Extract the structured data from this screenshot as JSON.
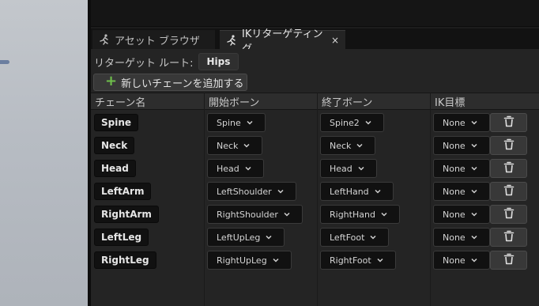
{
  "tabs": [
    {
      "label": "アセット ブラウザ",
      "icon": "running-figure-icon",
      "active": false
    },
    {
      "label": "IKリターゲティング",
      "icon": "running-figure-icon",
      "active": true,
      "close": "×"
    }
  ],
  "root": {
    "label": "リターゲット ルート:",
    "value": "Hips"
  },
  "add_chain": {
    "label": "新しいチェーンを追加する",
    "icon": "plus-icon"
  },
  "columns": [
    "チェーン名",
    "開始ボーン",
    "終了ボーン",
    "IK目標"
  ],
  "chains": [
    {
      "name": "Spine",
      "start": "Spine",
      "end": "Spine2",
      "ik": "None"
    },
    {
      "name": "Neck",
      "start": "Neck",
      "end": "Neck",
      "ik": "None"
    },
    {
      "name": "Head",
      "start": "Head",
      "end": "Head",
      "ik": "None"
    },
    {
      "name": "LeftArm",
      "start": "LeftShoulder",
      "end": "LeftHand",
      "ik": "None"
    },
    {
      "name": "RightArm",
      "start": "RightShoulder",
      "end": "RightHand",
      "ik": "None"
    },
    {
      "name": "LeftLeg",
      "start": "LeftUpLeg",
      "end": "LeftFoot",
      "ik": "None"
    },
    {
      "name": "RightLeg",
      "start": "RightUpLeg",
      "end": "RightFoot",
      "ik": "None"
    }
  ],
  "colors": {
    "accent_plus": "#6fc04b",
    "panel_bg": "#242424",
    "viewport": "#b7bcc3"
  }
}
